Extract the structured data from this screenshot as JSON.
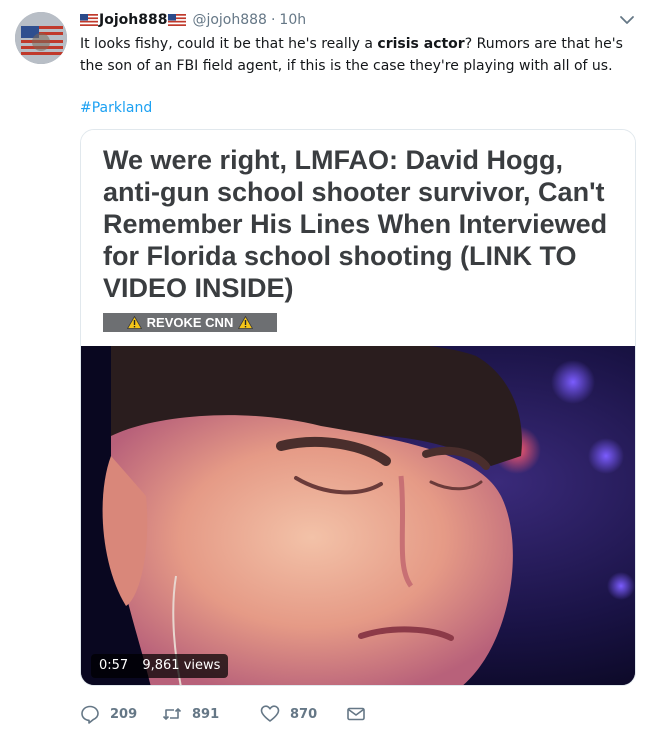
{
  "user": {
    "display_name": "Jojoh888",
    "handle": "@jojoh888",
    "time": "10h",
    "separator": "·"
  },
  "tweet": {
    "text_before": "It looks fishy, could it be that he's really a ",
    "text_bold": "crisis actor",
    "text_after": "? Rumors are that he's the son of an FBI field agent, if this is the case they're playing with all of us.",
    "hashtag": "#Parkland"
  },
  "card": {
    "headline": "We were right, LMFAO: David Hogg, anti-gun school shooter survivor, Can't Remember His Lines When Interviewed for Florida school shooting (LINK TO VIDEO INSIDE)",
    "banner": "REVOKE CNN"
  },
  "video": {
    "duration": "0:57",
    "views": "9,861 views"
  },
  "actions": {
    "replies": "209",
    "retweets": "891",
    "likes": "870"
  },
  "icons": {
    "flag": "us-flag-icon",
    "menu": "chevron-down-icon",
    "reply": "reply-icon",
    "retweet": "retweet-icon",
    "like": "heart-icon",
    "dm": "envelope-icon",
    "warning": "warning-icon"
  },
  "colors": {
    "link": "#1da1f2",
    "muted": "#657786",
    "text": "#14171a",
    "border": "#e1e8ed",
    "banner": "#6d6f72",
    "warning": "#f5c518"
  }
}
